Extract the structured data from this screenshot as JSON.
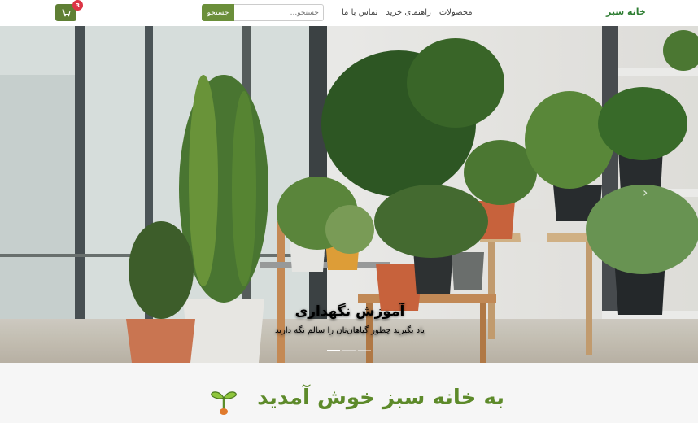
{
  "nav": {
    "brand": "خانه سبز",
    "links": [
      "محصولات",
      "راهنمای خرید",
      "تماس با ما"
    ],
    "search_placeholder": "جستجو...",
    "search_button": "جستجو",
    "cart_count": "3"
  },
  "hero": {
    "title": "آموزش نگهداری",
    "text": "یاد بگیرید چطور گیاهان‌تان را سالم نگه دارید",
    "slides": 3,
    "active_slide": 1
  },
  "welcome": {
    "title": "به خانه سبز خوش آمدید"
  },
  "colors": {
    "brand": "#2e7d32",
    "accent": "#6b8f3a",
    "badge": "#dc3545"
  },
  "icons": {
    "cart": "cart-icon",
    "next": "chevron-right-icon",
    "sprout": "sprout-icon"
  }
}
